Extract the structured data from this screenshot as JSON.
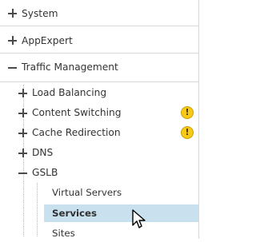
{
  "navigation": {
    "top_items": [
      {
        "label": "System"
      },
      {
        "label": "AppExpert"
      },
      {
        "label": "Traffic Management"
      }
    ],
    "traffic_management_children": [
      {
        "label": "Load Balancing",
        "warning_symbol": ""
      },
      {
        "label": "Content Switching",
        "warning_symbol": "!"
      },
      {
        "label": "Cache Redirection",
        "warning_symbol": "!"
      },
      {
        "label": "DNS",
        "warning_symbol": ""
      },
      {
        "label": "GSLB",
        "warning_symbol": ""
      }
    ],
    "gslb_children": [
      {
        "label": "Virtual Servers"
      },
      {
        "label": "Services"
      },
      {
        "label": "Sites"
      }
    ],
    "selected_item": "Services"
  },
  "icons": {
    "collapsed": "plus-icon",
    "expanded": "minus-icon",
    "warning": "warning-icon",
    "cursor": "mouse-pointer-icon"
  },
  "colors": {
    "selection_background": "#c9e1ef",
    "warning_fill": "#f7ca16",
    "divider": "#d7d7d7"
  }
}
